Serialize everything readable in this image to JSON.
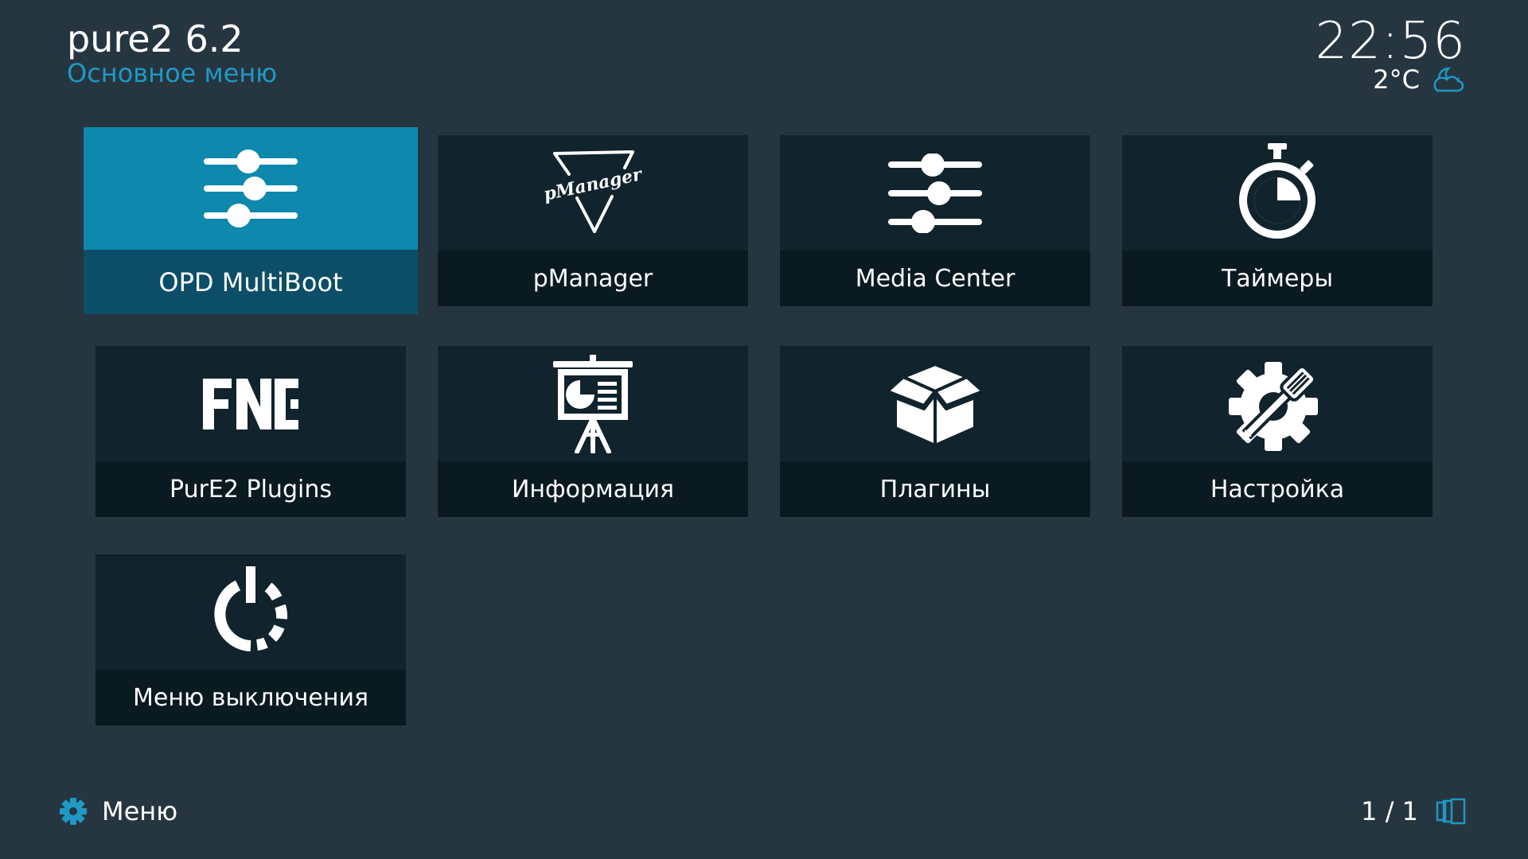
{
  "header": {
    "title": "pure2 6.2",
    "subtitle": "Основное меню",
    "clock": "22:56",
    "temperature": "2°C",
    "weather_icon": "partly-cloudy-night-icon"
  },
  "tiles": [
    {
      "label": "OPD MultiBoot",
      "icon": "sliders-icon",
      "focused": true
    },
    {
      "label": "pManager",
      "icon": "pmanager-logo-icon",
      "focused": false
    },
    {
      "label": "Media Center",
      "icon": "sliders-icon",
      "focused": false
    },
    {
      "label": "Таймеры",
      "icon": "stopwatch-icon",
      "focused": false
    },
    {
      "label": "PurE2 Plugins",
      "icon": "fnc-logo-icon",
      "focused": false
    },
    {
      "label": "Информация",
      "icon": "presentation-board-icon",
      "focused": false
    },
    {
      "label": "Плагины",
      "icon": "open-box-icon",
      "focused": false
    },
    {
      "label": "Настройка",
      "icon": "gear-screwdriver-icon",
      "focused": false
    },
    {
      "label": "Меню выключения",
      "icon": "power-icon",
      "focused": false
    }
  ],
  "footer": {
    "menu_label": "Меню",
    "menu_icon": "gear-icon",
    "page_counter": "1 / 1",
    "pages_icon": "pages-icon"
  },
  "colors": {
    "background": "#263641",
    "accent": "#1f98c4",
    "tile": "#11232c",
    "tile_label_bar": "#0a1a21",
    "focused_tile": "#0e88ad",
    "focused_label_bar": "#0c4e67"
  }
}
